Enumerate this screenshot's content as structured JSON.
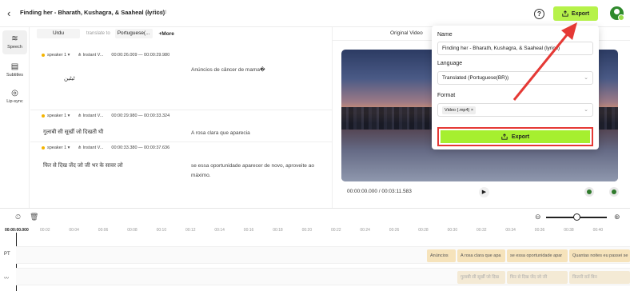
{
  "header": {
    "back_icon": "arrow-left-icon",
    "title": "Finding her - Bharath, Kushagra, & Saaheal (lyrics)",
    "saved_label": "Saved",
    "help_label": "?",
    "export_label": "Export"
  },
  "sidebar": {
    "items": [
      {
        "label": "Speech",
        "icon": "speech-icon"
      },
      {
        "label": "Subtitles",
        "icon": "subtitles-icon"
      },
      {
        "label": "Lip-sync",
        "icon": "lipsync-icon"
      }
    ]
  },
  "transcript": {
    "source_language": "Urdu",
    "translate_to_label": "translate to",
    "target_language": "Portuguese(...",
    "more_label": "+More",
    "segments": [
      {
        "speaker": "speaker 1",
        "voice": "Instant V...",
        "time_range": "00:00:26.009 — 00:00:29.980",
        "source": "ٹیٹین",
        "target": "Anúncios de câncer de mama�"
      },
      {
        "speaker": "speaker 1",
        "voice": "Instant V...",
        "time_range": "00:00:29.980 — 00:00:33.324",
        "source": "गुलाबी सी सूर्खी जो दिखती थी",
        "target": "A rosa clara que aparecia"
      },
      {
        "speaker": "speaker 1",
        "voice": "Instant V...",
        "time_range": "00:00:33.380 — 00:00:37.636",
        "source": "फिर से दिख जेंद जो जी भर के सावर लो",
        "target": "se essa oportunidade aparecer de novo, aproveite ao máximo."
      }
    ]
  },
  "video": {
    "tab_label": "Original Video",
    "time": "00:00:00.000 / 00:03:11.583"
  },
  "export_panel": {
    "name_label": "Name",
    "name_value": "Finding her - Bharath, Kushagra, & Saaheal (lyrics)",
    "language_label": "Language",
    "language_value": "Translated (Portuguese(BR))",
    "format_label": "Format",
    "format_chip": "Video (.mp4)",
    "chip_close": "×",
    "export_button": "Export"
  },
  "timeline": {
    "ticks": [
      "00:00:00.000",
      "00:02",
      "00:04",
      "00:06",
      "00:08",
      "00:10",
      "00:12",
      "00:14",
      "00:16",
      "00:18",
      "00:20",
      "00:22",
      "00:24",
      "00:26",
      "00:28",
      "00:30",
      "00:32",
      "00:34",
      "00:36",
      "00:38",
      "00:40"
    ],
    "track_pt_label": "PT",
    "clips_pt": [
      "Anúncios",
      "A rosa clara que apa",
      "se essa oportunidade apar",
      "Quantas noites eu passei se"
    ],
    "clips_src": [
      "गुलाबी सी सूर्खी जो दिख",
      "फिर से दिख जेंद जो जी",
      "कितनी रातें बिन"
    ]
  }
}
